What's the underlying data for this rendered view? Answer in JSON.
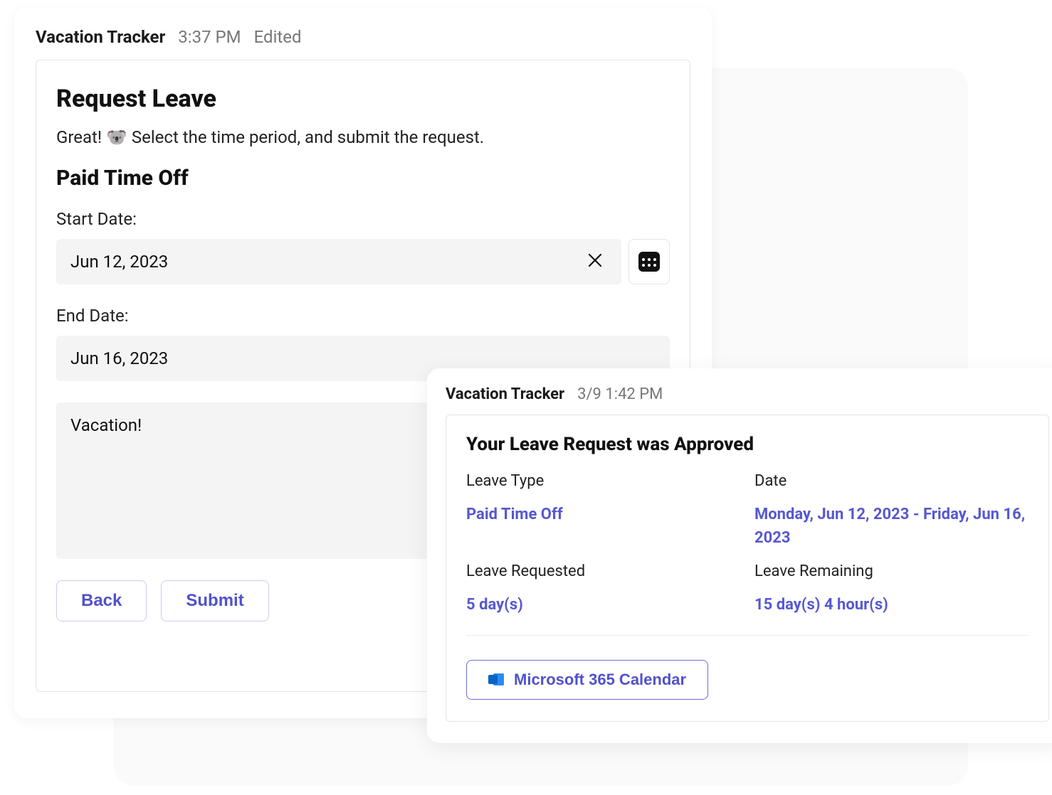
{
  "left_card": {
    "app_name": "Vacation Tracker",
    "timestamp": "3:37 PM",
    "edited_label": "Edited",
    "title": "Request Leave",
    "intro_text": "Great! 🐨 Select the time period, and submit the request.",
    "section_title": "Paid Time Off",
    "start_date_label": "Start Date:",
    "start_date_value": "Jun 12, 2023",
    "end_date_label": "End Date:",
    "end_date_value": "Jun 16, 2023",
    "note_value": "Vacation!",
    "back_button": "Back",
    "submit_button": "Submit"
  },
  "right_card": {
    "app_name": "Vacation Tracker",
    "timestamp": "3/9 1:42 PM",
    "title": "Your Leave Request was Approved",
    "leave_type_label": "Leave Type",
    "leave_type_value": "Paid Time Off",
    "date_label": "Date",
    "date_value": "Monday, Jun 12, 2023 - Friday, Jun 16, 2023",
    "leave_requested_label": "Leave Requested",
    "leave_requested_value": "5 day(s)",
    "leave_remaining_label": "Leave Remaining",
    "leave_remaining_value": "15 day(s) 4 hour(s)",
    "calendar_button": "Microsoft 365 Calendar"
  }
}
